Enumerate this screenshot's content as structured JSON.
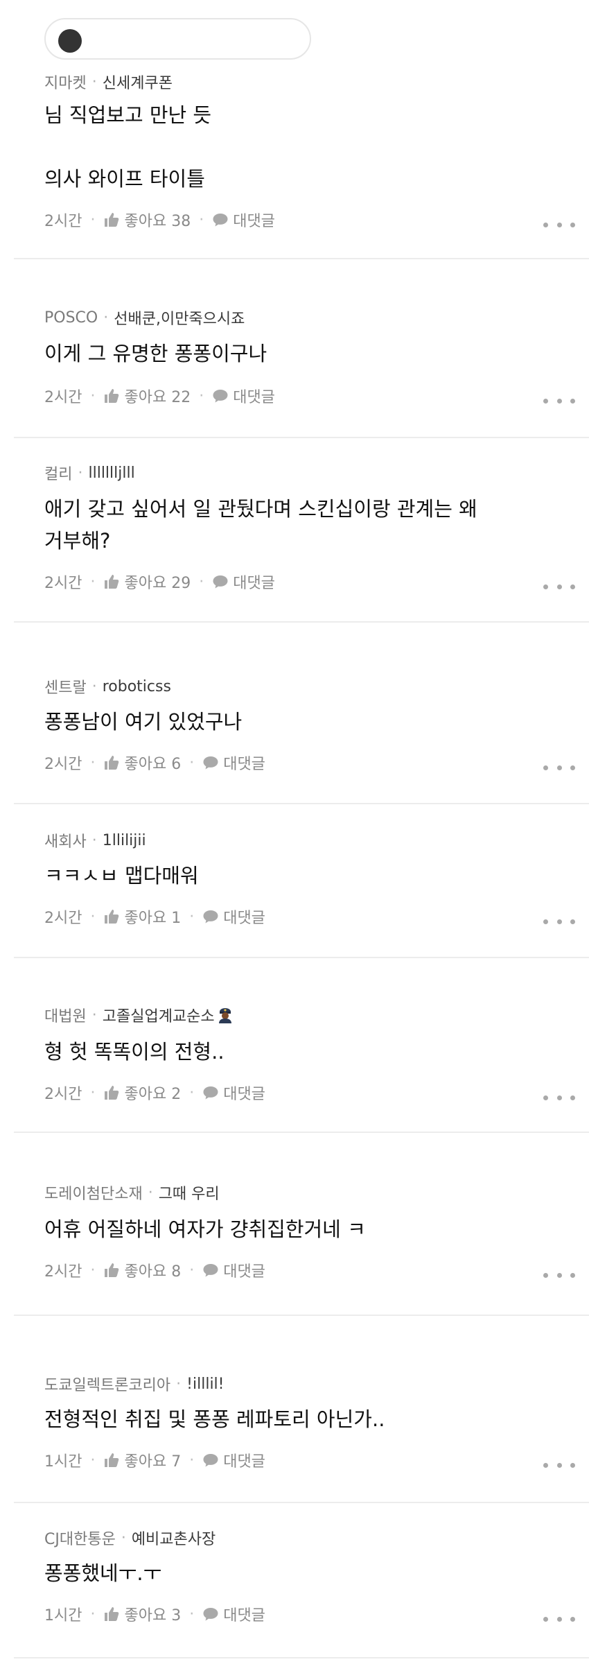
{
  "comments": [
    {
      "company": "지마켓",
      "nickname": "신세계쿠폰",
      "text": "님 직업보고 만난 듯\n\n의사 와이프 타이틀",
      "time": "2시간",
      "like_label": "좋아요 38",
      "reply_label": "대댓글"
    },
    {
      "company": "POSCO",
      "nickname": "선배쿤,이만죽으시죠",
      "text": "이게 그 유명한 퐁퐁이구나",
      "time": "2시간",
      "like_label": "좋아요 22",
      "reply_label": "대댓글"
    },
    {
      "company": "컬리",
      "nickname": "llllllljlll",
      "text": "애기 갖고 싶어서 일 관뒀다며 스킨십이랑 관계는 왜\n거부해?",
      "time": "2시간",
      "like_label": "좋아요 29",
      "reply_label": "대댓글"
    },
    {
      "company": "센트랄",
      "nickname": "roboticss",
      "text": "퐁퐁남이 여기 있었구나",
      "time": "2시간",
      "like_label": "좋아요 6",
      "reply_label": "대댓글"
    },
    {
      "company": "새회사",
      "nickname": "1llilijii",
      "text": "ㅋㅋㅅㅂ 맵다매워",
      "time": "2시간",
      "like_label": "좋아요 1",
      "reply_label": "대댓글"
    },
    {
      "company": "대법원",
      "nickname": "고졸실업계교순소",
      "text": "형 헛 똑똑이의 전형..",
      "time": "2시간",
      "like_label": "좋아요 2",
      "reply_label": "대댓글",
      "badge_icon": "police-officer-emoji"
    },
    {
      "company": "도레이첨단소재",
      "nickname": "그때 우리",
      "text": "어휴 어질하네 여자가 걍취집한거네 ㅋ",
      "time": "2시간",
      "like_label": "좋아요 8",
      "reply_label": "대댓글"
    },
    {
      "company": "도쿄일렉트론코리아",
      "nickname": "!illlil!",
      "text": "전형적인 취집 및 퐁퐁 레파토리 아닌가..",
      "time": "1시간",
      "like_label": "좋아요 7",
      "reply_label": "대댓글"
    },
    {
      "company": "CJ대한통운",
      "nickname": "예비교촌사장",
      "text": "퐁퐁했네ㅜ.ㅜ",
      "time": "1시간",
      "like_label": "좋아요 3",
      "reply_label": "대댓글"
    }
  ],
  "icons": {
    "like": "thumbs-up-icon",
    "reply": "speech-bubble-icon",
    "more": "more-options-icon"
  },
  "colors": {
    "meta_text": "#7a7a7a",
    "body_text": "#111111",
    "action_text": "#8a8a8a",
    "divider": "#ececec"
  }
}
